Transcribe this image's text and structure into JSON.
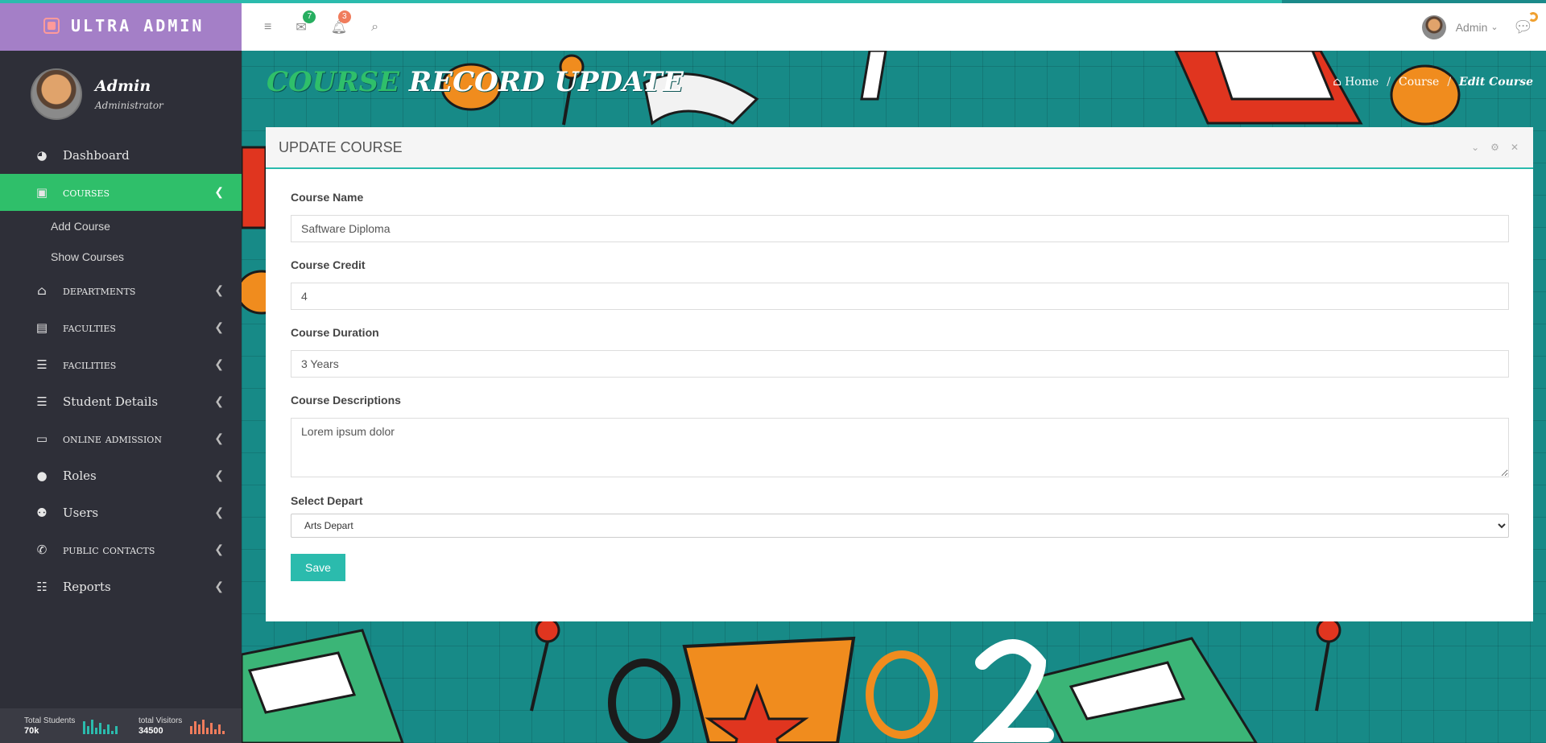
{
  "brand": {
    "name": "ULTRA ADMIN"
  },
  "profile": {
    "name": "Admin",
    "role": "Administrator"
  },
  "sidebar": {
    "items": [
      {
        "label": "Dashboard",
        "icon": "palette-icon"
      },
      {
        "label": "COURSES",
        "icon": "book-icon",
        "active": true
      },
      {
        "label": "DEPARTMENTS",
        "icon": "bank-icon"
      },
      {
        "label": "FACULTIES",
        "icon": "chalkboard-teacher-icon"
      },
      {
        "label": "FACILITIES",
        "icon": "list-check-icon"
      },
      {
        "label": "Student Details",
        "icon": "list-check-icon"
      },
      {
        "label": "ONLINE ADMISSION",
        "icon": "id-card-icon"
      },
      {
        "label": "Roles",
        "icon": "user-circle-icon"
      },
      {
        "label": "Users",
        "icon": "users-icon"
      },
      {
        "label": "PUBLIC CONTACTS",
        "icon": "phone-icon"
      },
      {
        "label": "Reports",
        "icon": "bar-chart-icon"
      }
    ],
    "submenu": [
      "Add Course",
      "Show Courses"
    ]
  },
  "footer": {
    "students_label": "Total Students",
    "students_value": "70k",
    "visitors_label": "total Visitors",
    "visitors_value": "34500",
    "students_color": "#2bbbad",
    "visitors_color": "#f07c5c"
  },
  "header": {
    "mail_badge": "7",
    "bell_badge": "3",
    "user": "Admin"
  },
  "page": {
    "title_highlight": "COURSE",
    "title_rest": "RECORD UPDATE",
    "breadcrumb": [
      "Home",
      "Course",
      "Edit Course"
    ]
  },
  "panel": {
    "title": "UPDATE COURSE",
    "fields": {
      "name_label": "Course Name",
      "name_value": "Saftware Diploma",
      "credit_label": "Course Credit",
      "credit_value": "4",
      "duration_label": "Course Duration",
      "duration_value": "3 Years",
      "desc_label": "Course Descriptions",
      "desc_value": "Lorem ipsum dolor",
      "depart_label": "Select Depart",
      "depart_value": "Arts Depart"
    },
    "save_label": "Save"
  },
  "colors": {
    "accent": "#2bbbad",
    "active": "#2fbf6a",
    "brand": "#a47fc7",
    "sidebar": "#2e2f38"
  }
}
